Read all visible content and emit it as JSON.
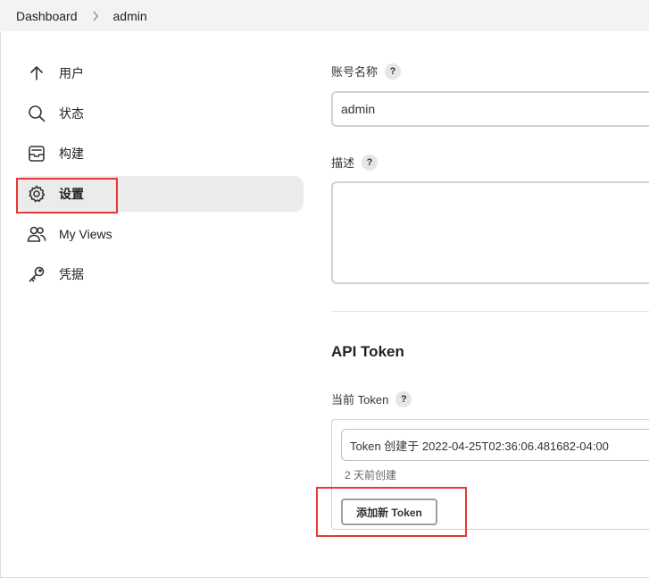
{
  "breadcrumb": {
    "items": [
      "Dashboard",
      "admin"
    ]
  },
  "sidebar": {
    "items": [
      {
        "label": "用户",
        "icon": "arrow-up-icon"
      },
      {
        "label": "状态",
        "icon": "search-icon"
      },
      {
        "label": "构建",
        "icon": "inbox-icon"
      },
      {
        "label": "设置",
        "icon": "gear-icon",
        "active": true
      },
      {
        "label": "My Views",
        "icon": "people-icon"
      },
      {
        "label": "凭据",
        "icon": "key-icon"
      }
    ]
  },
  "form": {
    "account_label": "账号名称",
    "account_value": "admin",
    "description_label": "描述",
    "description_value": "",
    "help_glyph": "?"
  },
  "api_token": {
    "title": "API Token",
    "current_label": "当前 Token",
    "token_value": "Token 创建于 2022-04-25T02:36:06.481682-04:00",
    "created_note": "2 天前创建",
    "add_button": "添加新 Token"
  },
  "colors": {
    "highlight": "#e53935",
    "active_bg": "#ebebeb"
  }
}
